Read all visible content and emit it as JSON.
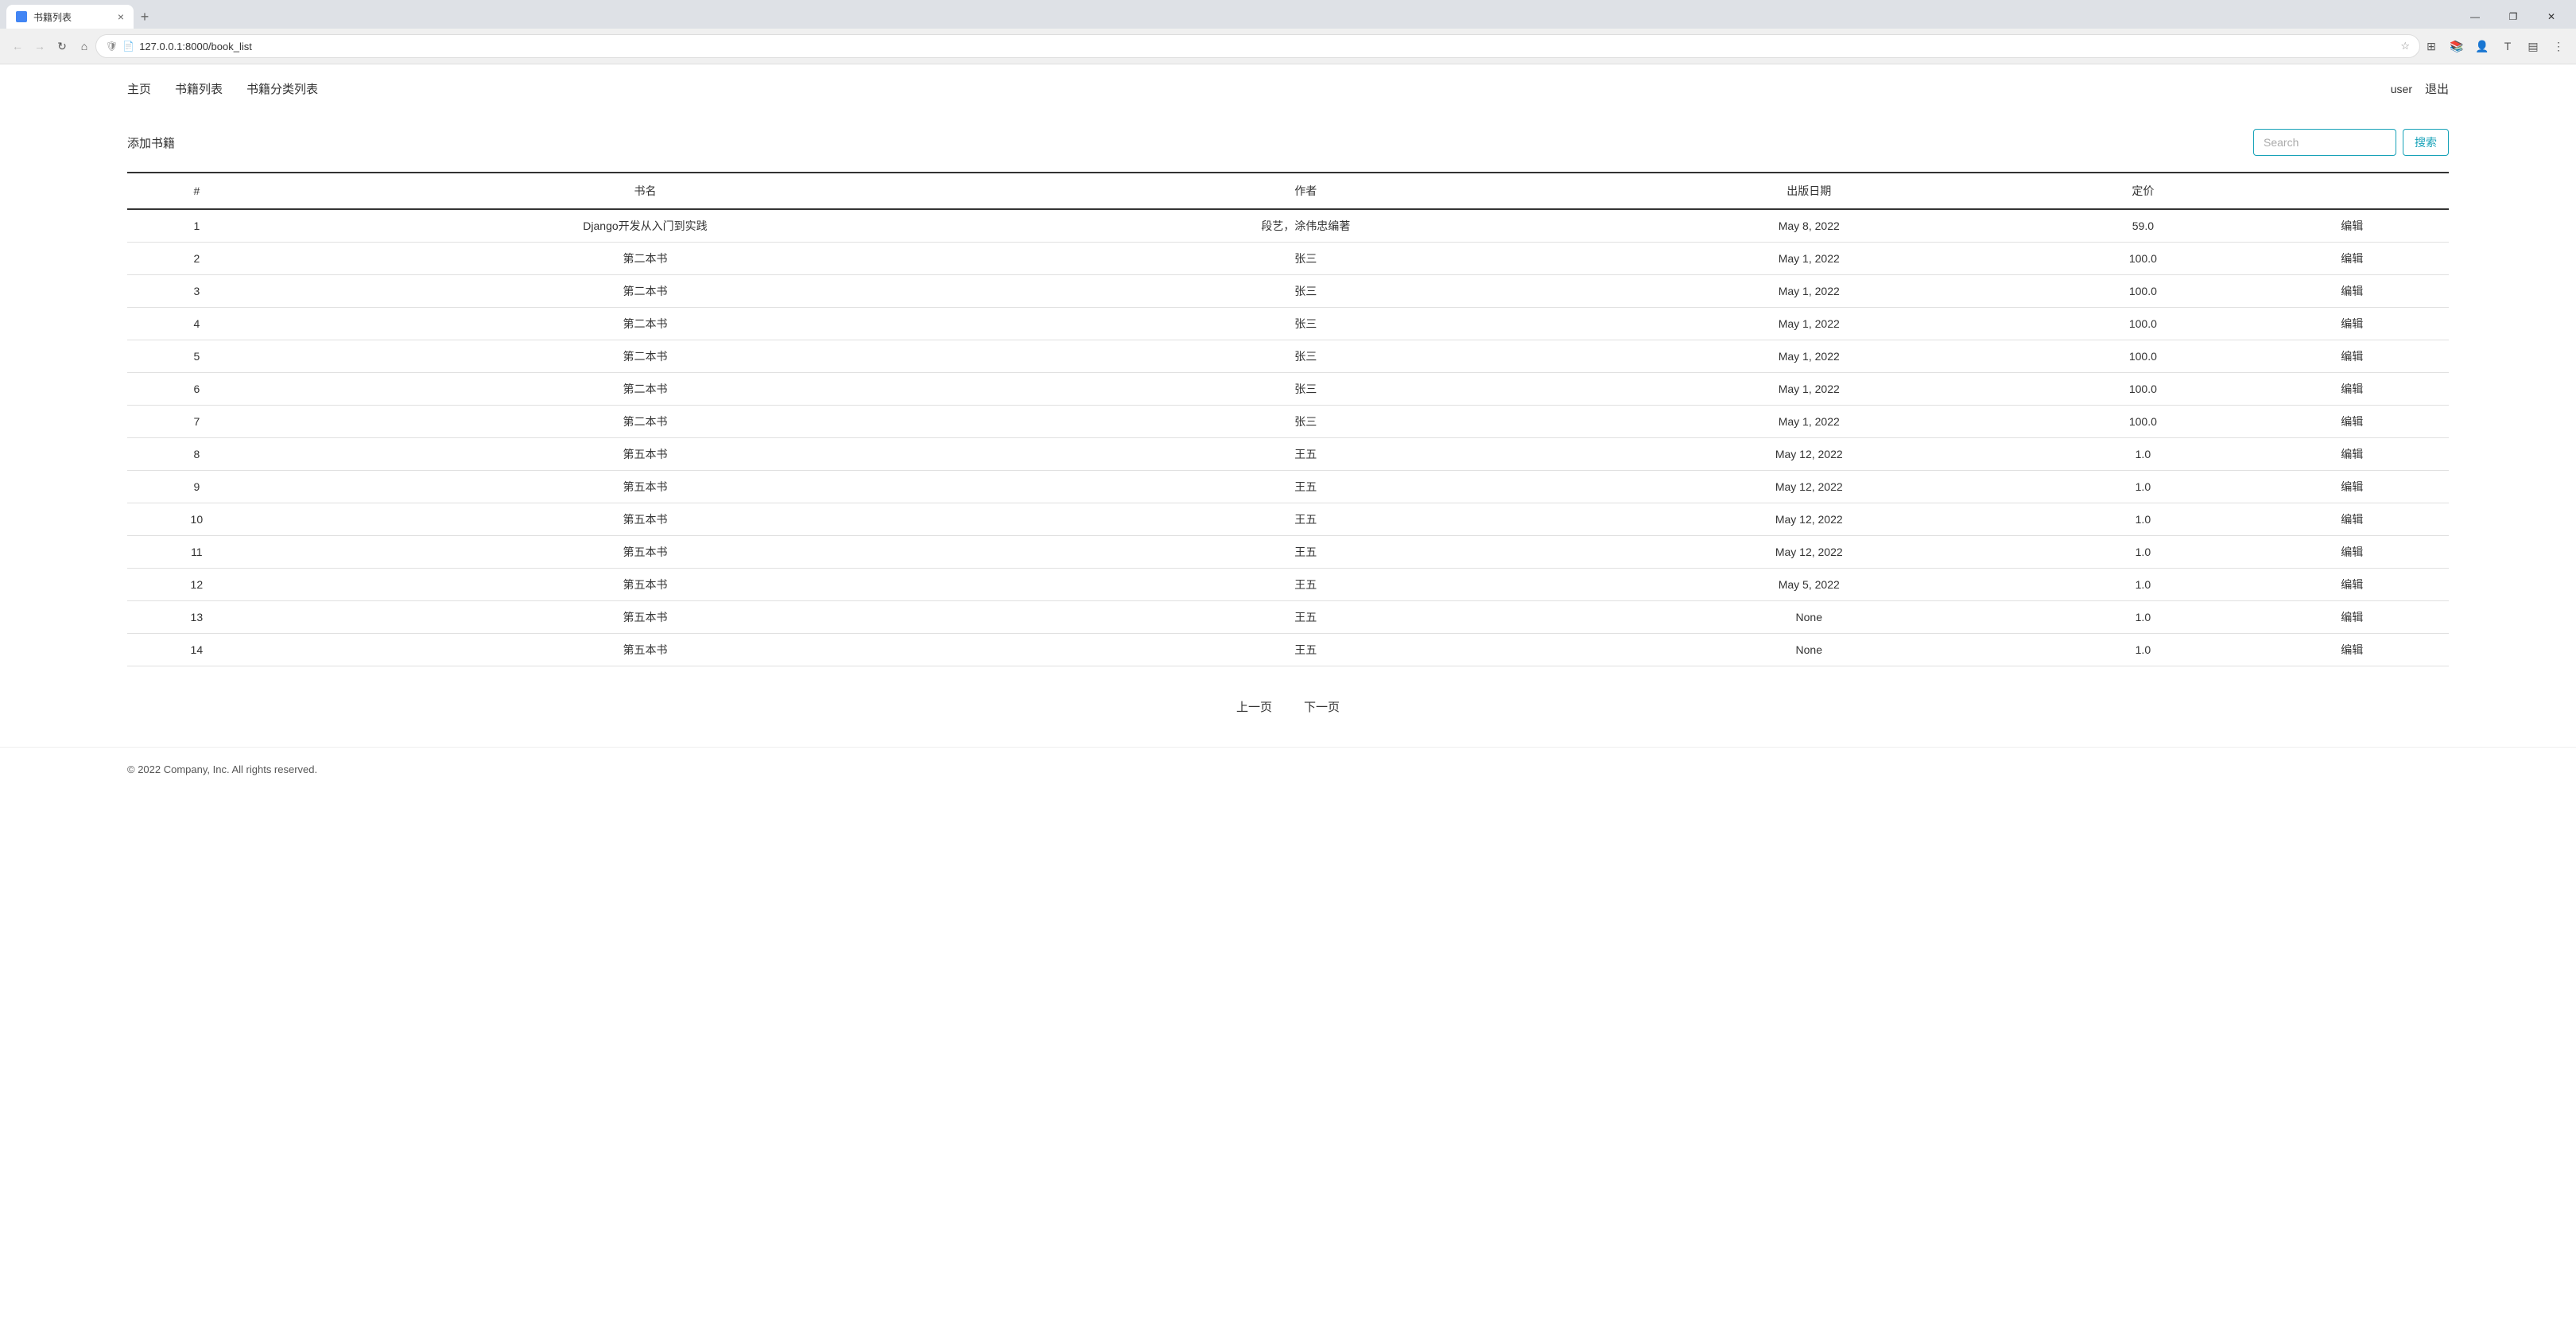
{
  "browser": {
    "tab_title": "书籍列表",
    "url": "127.0.0.1:8000/book_list",
    "nav_back": "←",
    "nav_forward": "→",
    "nav_refresh": "↻",
    "nav_home": "⌂",
    "tab_close": "×",
    "tab_new": "+",
    "win_minimize": "—",
    "win_restore": "❐",
    "win_close": "✕"
  },
  "navbar": {
    "links": [
      {
        "label": "主页",
        "id": "home"
      },
      {
        "label": "书籍列表",
        "id": "book-list"
      },
      {
        "label": "书籍分类列表",
        "id": "category-list"
      }
    ],
    "user_label": "user",
    "logout_label": "退出"
  },
  "toolbar": {
    "add_book_label": "添加书籍",
    "search_placeholder": "Search",
    "search_btn_label": "搜索"
  },
  "table": {
    "headers": [
      "#",
      "书名",
      "作者",
      "出版日期",
      "定价",
      ""
    ],
    "rows": [
      {
        "id": 1,
        "title": "Django开发从入门到实践",
        "author": "段艺，涂伟忠编著",
        "pub_date": "May 8, 2022",
        "price": "59.0",
        "action": "编辑"
      },
      {
        "id": 2,
        "title": "第二本书",
        "author": "张三",
        "pub_date": "May 1, 2022",
        "price": "100.0",
        "action": "编辑"
      },
      {
        "id": 3,
        "title": "第二本书",
        "author": "张三",
        "pub_date": "May 1, 2022",
        "price": "100.0",
        "action": "编辑"
      },
      {
        "id": 4,
        "title": "第二本书",
        "author": "张三",
        "pub_date": "May 1, 2022",
        "price": "100.0",
        "action": "编辑"
      },
      {
        "id": 5,
        "title": "第二本书",
        "author": "张三",
        "pub_date": "May 1, 2022",
        "price": "100.0",
        "action": "编辑"
      },
      {
        "id": 6,
        "title": "第二本书",
        "author": "张三",
        "pub_date": "May 1, 2022",
        "price": "100.0",
        "action": "编辑"
      },
      {
        "id": 7,
        "title": "第二本书",
        "author": "张三",
        "pub_date": "May 1, 2022",
        "price": "100.0",
        "action": "编辑"
      },
      {
        "id": 8,
        "title": "第五本书",
        "author": "王五",
        "pub_date": "May 12, 2022",
        "price": "1.0",
        "action": "编辑"
      },
      {
        "id": 9,
        "title": "第五本书",
        "author": "王五",
        "pub_date": "May 12, 2022",
        "price": "1.0",
        "action": "编辑"
      },
      {
        "id": 10,
        "title": "第五本书",
        "author": "王五",
        "pub_date": "May 12, 2022",
        "price": "1.0",
        "action": "编辑"
      },
      {
        "id": 11,
        "title": "第五本书",
        "author": "王五",
        "pub_date": "May 12, 2022",
        "price": "1.0",
        "action": "编辑"
      },
      {
        "id": 12,
        "title": "第五本书",
        "author": "王五",
        "pub_date": "May 5, 2022",
        "price": "1.0",
        "action": "编辑"
      },
      {
        "id": 13,
        "title": "第五本书",
        "author": "王五",
        "pub_date": "None",
        "price": "1.0",
        "action": "编辑"
      },
      {
        "id": 14,
        "title": "第五本书",
        "author": "王五",
        "pub_date": "None",
        "price": "1.0",
        "action": "编辑"
      }
    ]
  },
  "pagination": {
    "prev_label": "上一页",
    "next_label": "下一页"
  },
  "footer": {
    "copyright": "© 2022 Company, Inc. All rights reserved."
  }
}
